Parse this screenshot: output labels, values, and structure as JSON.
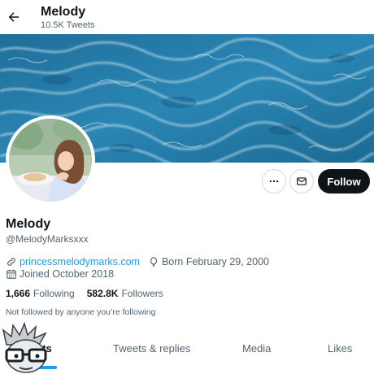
{
  "header": {
    "name": "Melody",
    "tweet_count": "10.5K Tweets",
    "back_icon": "arrow-left-icon"
  },
  "banner": {
    "description_icon": "ocean-waves",
    "colors": {
      "deep": "#1a5f86",
      "mid": "#2f8fc0",
      "foam": "#e6f4fb"
    }
  },
  "actions": {
    "more_icon": "more-icon",
    "message_icon": "mail-icon",
    "follow_label": "Follow"
  },
  "profile": {
    "name": "Melody",
    "handle": "@MelodyMarksxxx",
    "website": "princessmelodymarks.com",
    "birthday": "Born February 29, 2000",
    "joined": "Joined October 2018",
    "following_count": "1,666",
    "following_label": "Following",
    "followers_count": "582.8K",
    "followers_label": "Followers",
    "not_followed_text": "Not followed by anyone you’re following"
  },
  "tabs": [
    {
      "label": "Tweets",
      "visible": "ets",
      "active": true
    },
    {
      "label": "Tweets & replies",
      "active": false
    },
    {
      "label": "Media",
      "active": false
    },
    {
      "label": "Likes",
      "active": false
    }
  ],
  "colors": {
    "accent": "#1d9bf0",
    "text": "#0f1419",
    "muted": "#536471",
    "follow_bg": "#0f1419"
  }
}
